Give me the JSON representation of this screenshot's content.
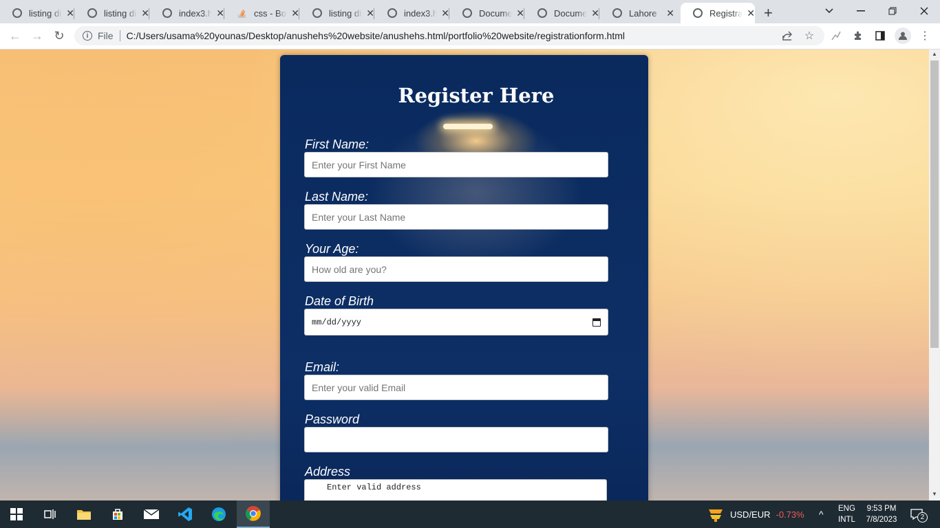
{
  "tabs": [
    {
      "title": "listing di",
      "icon": "globe-icon"
    },
    {
      "title": "listing di",
      "icon": "globe-icon"
    },
    {
      "title": "index3.h",
      "icon": "globe-icon"
    },
    {
      "title": "css - Boo",
      "icon": "stackoverflow-icon"
    },
    {
      "title": "listing di",
      "icon": "globe-icon"
    },
    {
      "title": "index3.h",
      "icon": "globe-icon"
    },
    {
      "title": "Docume",
      "icon": "globe-icon"
    },
    {
      "title": "Docume",
      "icon": "globe-icon"
    },
    {
      "title": "Lahore",
      "icon": "globe-icon"
    },
    {
      "title": "Registra",
      "icon": "globe-icon",
      "active": true
    }
  ],
  "address": {
    "scheme_label": "File",
    "url": "C:/Users/usama%20younas/Desktop/anushehs%20website/anushehs.html/portfolio%20website/registrationform.html"
  },
  "form": {
    "title": "Register Here",
    "first_name": {
      "label": "First Name:",
      "placeholder": "Enter your First Name"
    },
    "last_name": {
      "label": "Last Name:",
      "placeholder": "Enter your Last Name"
    },
    "age": {
      "label": "Your Age:",
      "placeholder": "How old are you?"
    },
    "dob": {
      "label": "Date of Birth",
      "value": "mm/dd/yyyy"
    },
    "email": {
      "label": "Email:",
      "placeholder": "Enter your valid Email"
    },
    "password": {
      "label": "Password",
      "value": ""
    },
    "address": {
      "label": "Address",
      "placeholder": "Enter valid address"
    }
  },
  "taskbar": {
    "ticker": "USD/EUR",
    "ticker_change": "-0.73%",
    "lang_top": "ENG",
    "lang_bottom": "INTL",
    "time": "9:53 PM",
    "date": "7/8/2023",
    "notifications": "2"
  },
  "colors": {
    "card_bg": "#0c2d62",
    "ticker_negative": "#f05a5a",
    "taskbar_bg": "#1f2b33"
  }
}
